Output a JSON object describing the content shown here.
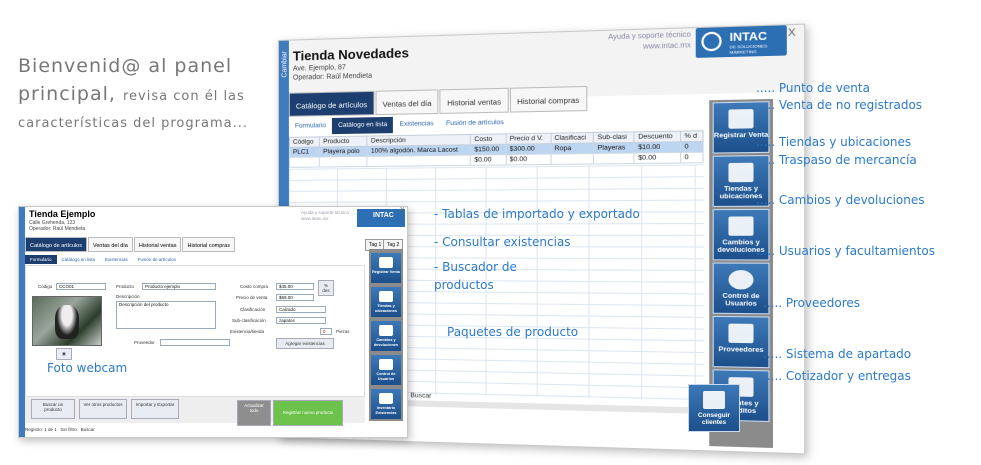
{
  "welcome": {
    "line1_big": "Bienvenid@",
    "line1_rest": "al panel",
    "line2_big": "principal,",
    "line2_rest": "revisa con él las",
    "line3": "características del programa..."
  },
  "big_window": {
    "side_label": "Cambiar",
    "title": "Tienda Novedades",
    "address": "Ave. Ejemplo, 87",
    "operator": "Operador: Raúl Mendieta",
    "links": [
      "Ayuda y soporte técnico",
      "www.intac.mx"
    ],
    "logo": "INTAC",
    "logo_sub": "DE SOLUCIONES MÁRKETING",
    "close": "X",
    "tabs": [
      "Catálogo de artículos",
      "Ventas del día",
      "Historial ventas",
      "Historial compras"
    ],
    "subtabs": [
      "Formulario",
      "Catálogo en lista",
      "Existencias",
      "Fusión de artículos"
    ],
    "columns": [
      "Código",
      "Producto",
      "Descripción",
      "Costo",
      "Precio d V.",
      "Clasificaci",
      "Sub-clasi",
      "Descuento",
      "% d"
    ],
    "rows": [
      [
        "PLC1",
        "Playera polo",
        "100% algodón. Marca Lacost",
        "$150.00",
        "$300.00",
        "Ropa",
        "Playeras",
        "$10.00",
        "0"
      ],
      [
        "",
        "",
        "",
        "$0.00",
        "$0.00",
        "",
        "",
        "$0.00",
        "0"
      ]
    ],
    "search_label": "Buscar",
    "nav": [
      {
        "label": "Registrar Venta",
        "icon": "cash-register-icon"
      },
      {
        "label": "Tiendas y ubicaciones",
        "icon": "store-icon"
      },
      {
        "label": "Cambios y devoluciones",
        "icon": "box-return-icon"
      },
      {
        "label": "Control de Usuarios",
        "icon": "user-lock-icon"
      },
      {
        "label": "Proveedores",
        "icon": "truck-icon"
      },
      {
        "label": "Clientes y Créditos",
        "icon": "calendar-icon"
      },
      {
        "label": "Conseguir clientes",
        "icon": "handshake-icon"
      }
    ]
  },
  "features": [
    "..... Punto de venta",
    "..... Venta de no registrados",
    "..... Tiendas y ubicaciones",
    "..... Traspaso de mercancía",
    "..... Cambios y devoluciones",
    "..... Usuarios y facultamientos",
    "..... Proveedores",
    "..... Sistema de apartado",
    "..... Cotizador y entregas"
  ],
  "small_window": {
    "side_label": "Cambiar",
    "title": "Tienda Ejemplo",
    "address": "Calle Grehenda, 123",
    "operator": "Operador: Raúl Mendieta",
    "links": [
      "Ayuda y soporte técnico",
      "www.intac.mx"
    ],
    "logo": "INTAC",
    "close": "X",
    "tabs": [
      "Catálogo de artículos",
      "Ventas del día",
      "Historial ventas",
      "Historial compras"
    ],
    "tag_buttons": [
      "Tag 1",
      "Tag 2"
    ],
    "subtabs": [
      "Formulario",
      "Catálogo en lista",
      "Existencias",
      "Fusión de artículos"
    ],
    "code_label": "Código",
    "code_value": "CCO01",
    "product_label": "Producto",
    "product_value": "Producto ejemplo",
    "description_label": "Descripción",
    "description_value": "Descripción del producto",
    "cost_label": "Costo compra",
    "cost_value": "$45.00",
    "price_label": "Precio de venta",
    "price_value": "$69.00",
    "discount_label": "% des",
    "class_label": "Clasificación",
    "class_value": "Calzado",
    "subclass_label": "Sub-clasificación",
    "subclass_value": "zapatos",
    "stock_label": "Existencia/tienda",
    "stock_value": "0",
    "stock_max": "Piezas",
    "supplier_label": "Proveedor",
    "add_stock": "Agregar existencias",
    "search_product": "Buscar un producto",
    "other_products": "Ver otros productos",
    "import_export": "Importar y Exportar",
    "refresh": "Actualizar todo",
    "register_product": "Registrar nuevo producto",
    "status_record": "Registro: 1 de 1",
    "status_filter": "Sin filtro",
    "status_search": "Buscar",
    "nav": [
      "Registrar Venta",
      "Tiendas y ubicaciones",
      "Cambios y devoluciones",
      "Control de Usuarios",
      "Inventario Existencias"
    ]
  },
  "notes": {
    "import_export": "- Tablas de importado y exportado",
    "stock": "- Consultar existencias",
    "search_1": "- Buscador de",
    "search_2": "productos",
    "packages": "Paquetes de producto",
    "webcam": "Foto webcam"
  }
}
